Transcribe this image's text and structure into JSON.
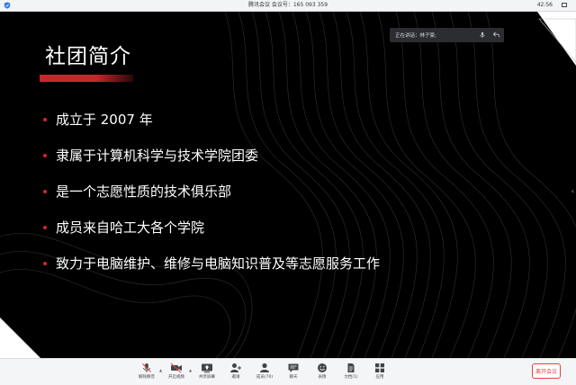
{
  "window": {
    "title": "腾讯会议 会议号：165 093 359",
    "clock": "42:56"
  },
  "slide": {
    "title": "社团简介",
    "bullets": [
      "成立于 2007 年",
      "隶属于计算机科学与技术学院团委",
      "是一个志愿性质的技术俱乐部",
      "成员来自哈工大各个学院",
      "致力于电脑维护、维修与电脑知识普及等志愿服务工作"
    ],
    "accent_color": "#c8262b"
  },
  "speaker": {
    "label": "正在讲话：林子豪;"
  },
  "toolbar": {
    "items": [
      {
        "name": "mute",
        "label": "解除静音",
        "icon": "mic-muted-icon"
      },
      {
        "name": "video",
        "label": "开启视频",
        "icon": "camera-off-icon"
      },
      {
        "name": "share",
        "label": "共享屏幕",
        "icon": "share-screen-icon"
      },
      {
        "name": "invite",
        "label": "邀请",
        "icon": "add-user-icon"
      },
      {
        "name": "members",
        "label": "成员(70)",
        "icon": "members-icon"
      },
      {
        "name": "chat",
        "label": "聊天",
        "icon": "chat-icon"
      },
      {
        "name": "reactions",
        "label": "表情",
        "icon": "smile-icon"
      },
      {
        "name": "docs",
        "label": "文档(1)",
        "icon": "document-icon"
      },
      {
        "name": "apps",
        "label": "应用",
        "icon": "apps-icon"
      }
    ],
    "end_label": "离开会议",
    "end_color": "#e1423d"
  }
}
